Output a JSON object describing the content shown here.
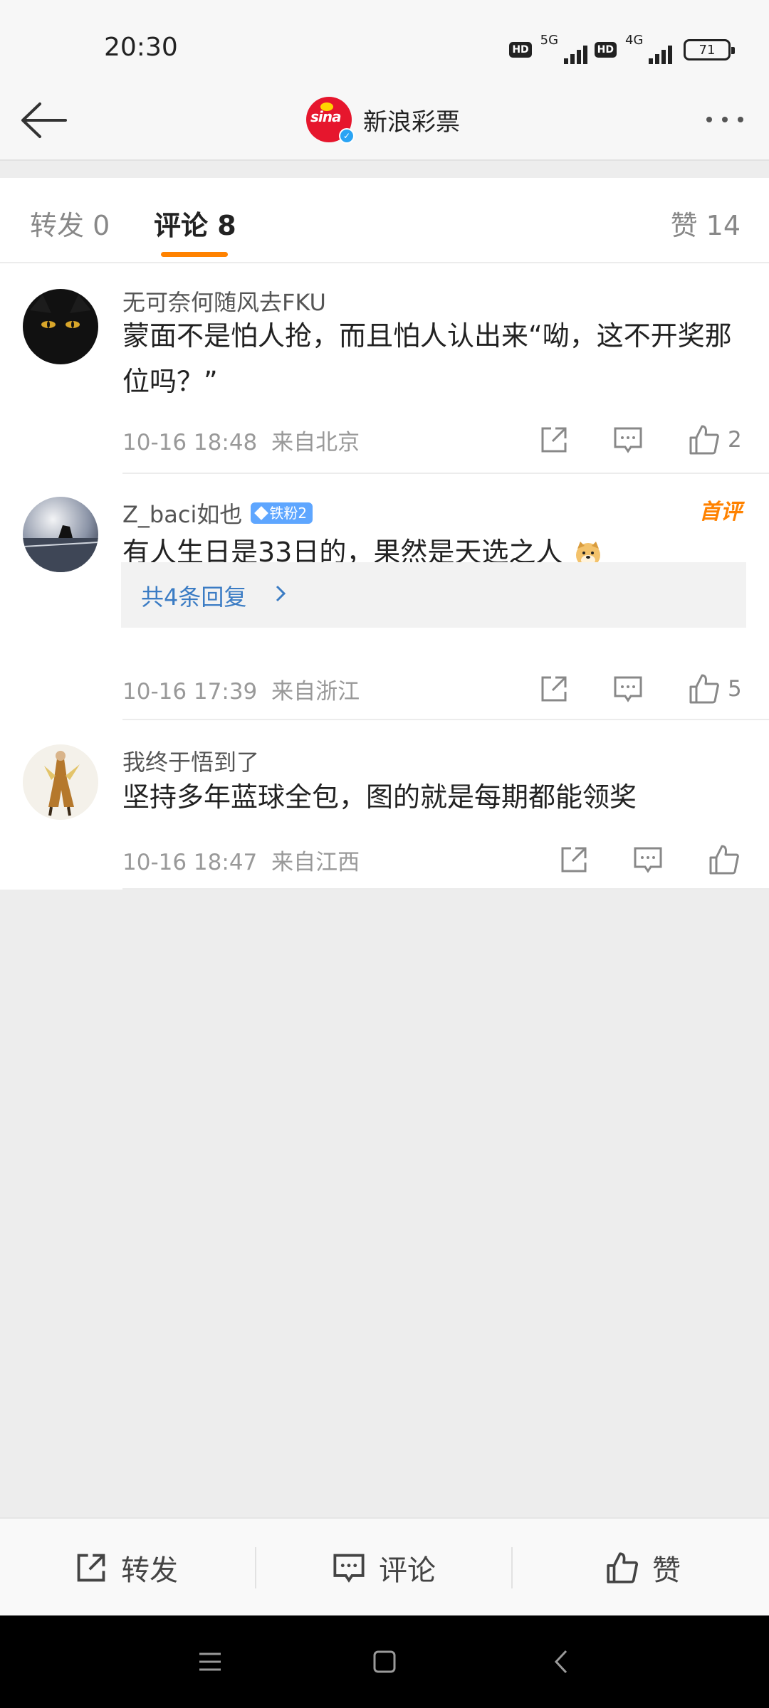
{
  "status_bar": {
    "time": "20:30",
    "hd1": "HD",
    "net1": "5G",
    "hd2": "HD",
    "net2": "4G",
    "battery": "71"
  },
  "header": {
    "title": "新浪彩票",
    "logo_text": "sina"
  },
  "tabs": {
    "repost": "转发 0",
    "comment": "评论 8",
    "like": "赞 14"
  },
  "comments": [
    {
      "username": "无可奈何随风去FKU",
      "text": "蒙面不是怕人抢，而且怕人认出来“呦，这不开奖那位吗？”",
      "time": "10-16 18:48",
      "location": "来自北京",
      "likes": "2"
    },
    {
      "username": "Z_baci如也",
      "badge": "铁粉2",
      "first_tag": "首评",
      "text": "有人生日是33日的，果然是天选之人",
      "reply_summary": "共4条回复",
      "time": "10-16 17:39",
      "location": "来自浙江",
      "likes": "5"
    },
    {
      "username": "我终于悟到了",
      "text": "坚持多年蓝球全包，图的就是每期都能领奖",
      "time": "10-16 18:47",
      "location": "来自江西",
      "likes": ""
    }
  ],
  "bottom_bar": {
    "repost": "转发",
    "comment": "评论",
    "like": "赞"
  },
  "colors": {
    "accent": "#ff8200",
    "link": "#3b7cc4",
    "badge": "#5ea6ff",
    "sina_red": "#e6162d"
  }
}
